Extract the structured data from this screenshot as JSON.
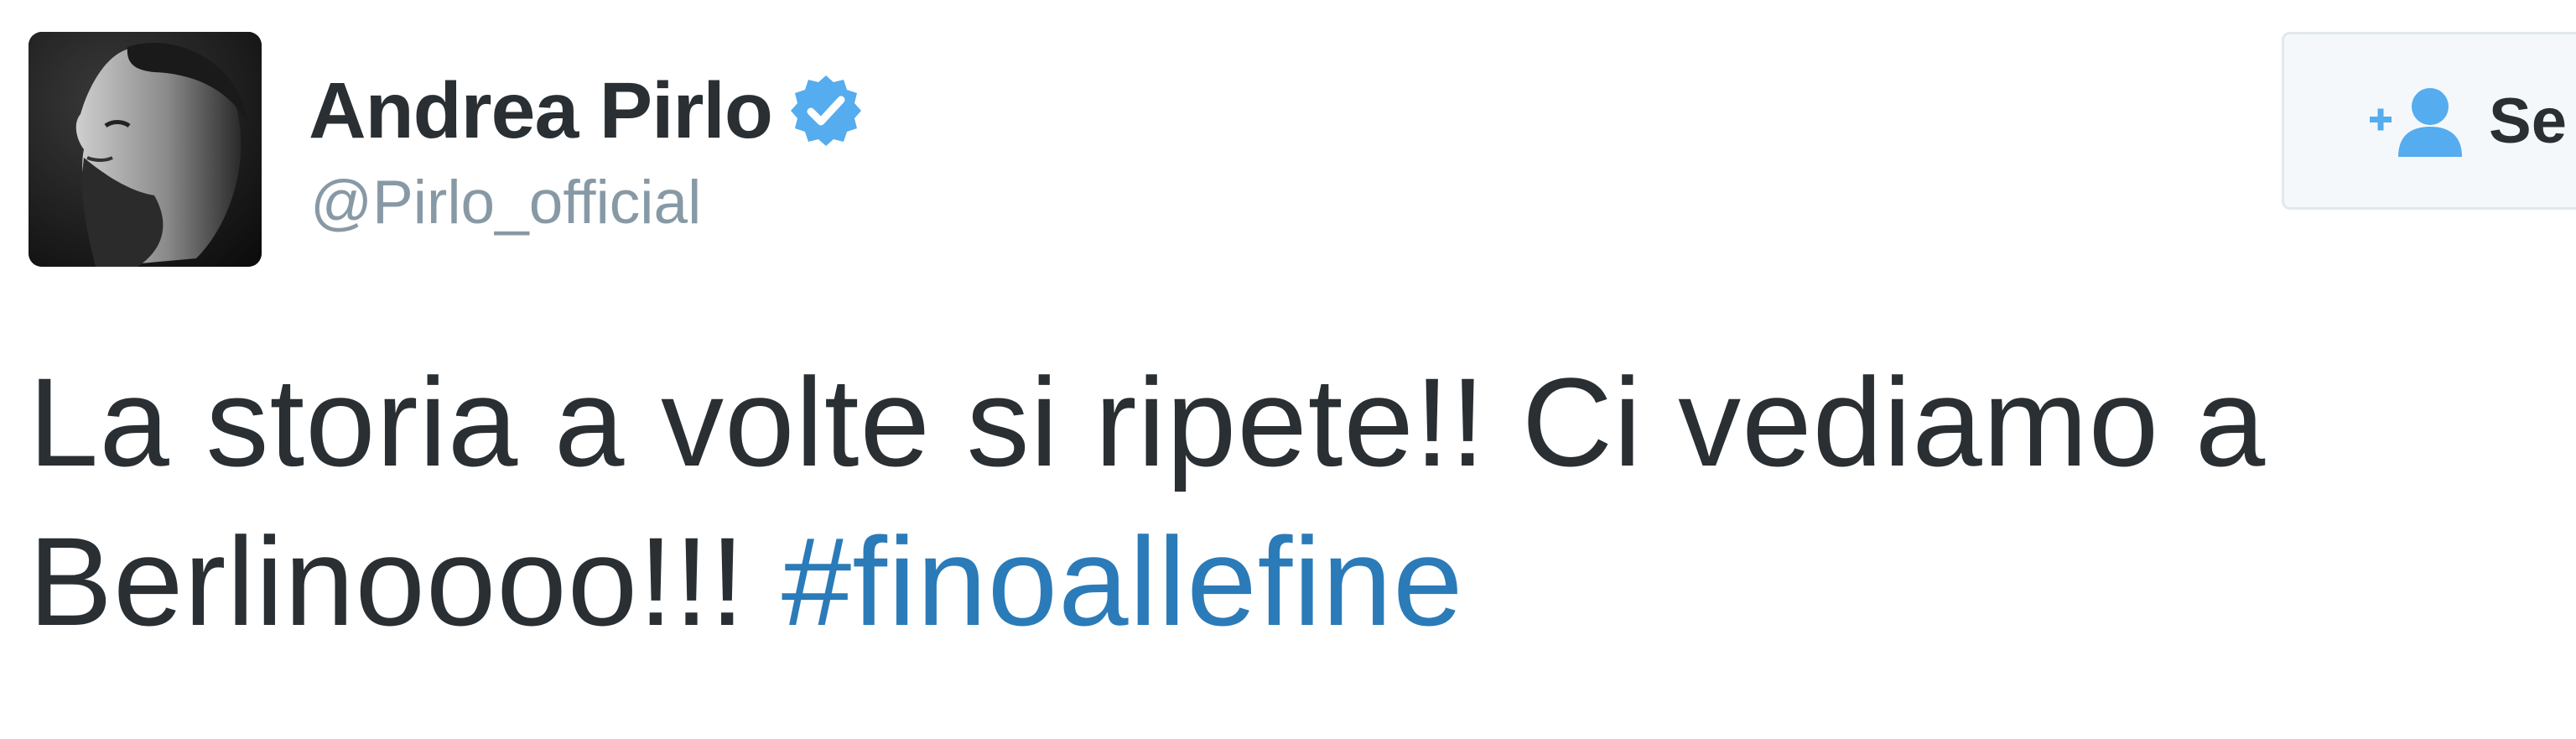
{
  "tweet": {
    "author": {
      "name": "Andrea Pirlo",
      "handle": "@Pirlo_official",
      "verified": true
    },
    "follow_button": {
      "label": "Se",
      "icon": "add-user-icon"
    },
    "text_line_1": "La storia a volte si ripete!! Ci vediamo a",
    "text_line_2_prefix": "Berlinoooo!!! ",
    "hashtag": "#finoallefine"
  },
  "colors": {
    "text": "#292f33",
    "handle": "#8899a6",
    "link": "#2b7bb9",
    "verified_badge": "#55acee",
    "follow_icon": "#55acee",
    "button_bg": "#f5f8fa",
    "button_border": "#e1e8ed"
  }
}
